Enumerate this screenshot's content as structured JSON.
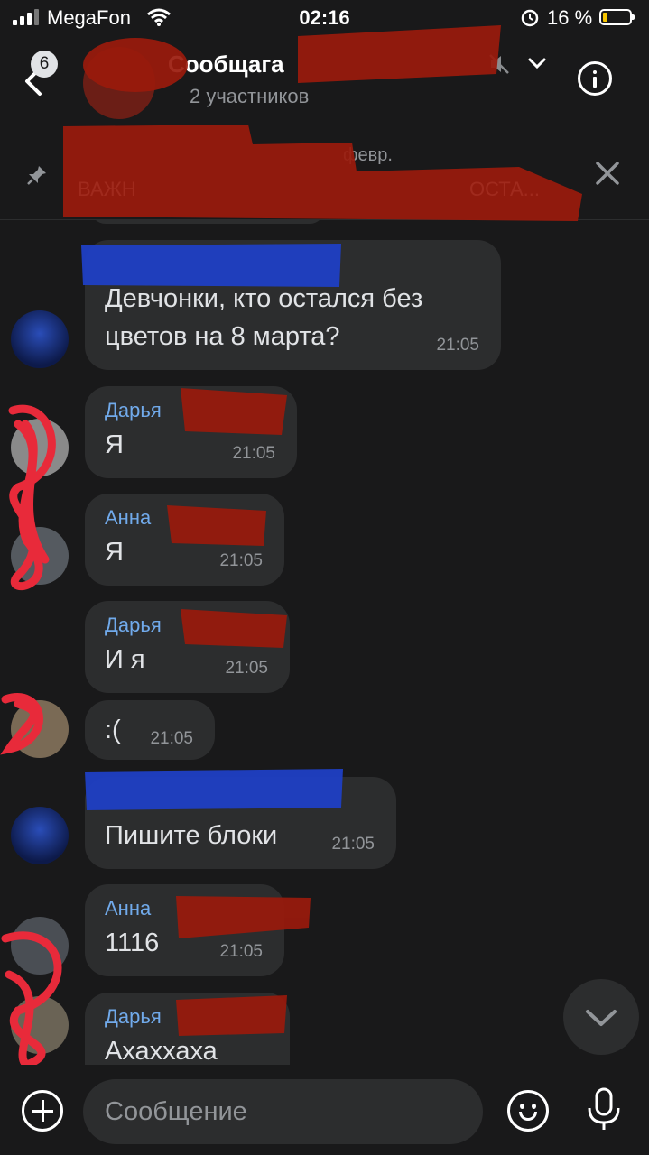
{
  "status_bar": {
    "carrier": "MegaFon",
    "time": "02:16",
    "battery_percent": "16 %",
    "battery_level": 0.16
  },
  "header": {
    "unread_count": "6",
    "title": "Сообщага",
    "subtitle": "2 участников",
    "back_icon": "chevron-left-icon",
    "mute_icon": "muted-speaker-icon",
    "menu_icon": "chevron-down-icon",
    "info_icon": "info-icon"
  },
  "pinned": {
    "title": "февр.",
    "text": "ВАЖН",
    "text_suffix": "ОСТА...",
    "pin_icon": "pin-icon",
    "close_icon": "close-icon"
  },
  "messages": [
    {
      "name": "",
      "text": "Девчонки, кто остался без цветов на 8 марта?",
      "time": "21:05"
    },
    {
      "name": "Дарья",
      "text": "Я",
      "time": "21:05"
    },
    {
      "name": "Анна",
      "text": "Я",
      "time": "21:05"
    },
    {
      "name": "Дарья",
      "text": "И я",
      "time": "21:05"
    },
    {
      "name": "",
      "text": ":(",
      "time": "21:05"
    },
    {
      "name": "",
      "text": "Пишите блоки",
      "time": "21:05"
    },
    {
      "name": "Анна",
      "text": "1116",
      "time": "21:05"
    },
    {
      "name": "Дарья",
      "text": "Ахаххаха",
      "time": ""
    }
  ],
  "composer": {
    "placeholder": "Сообщение",
    "attach_icon": "plus-circle-icon",
    "emoji_icon": "smile-icon",
    "mic_icon": "microphone-icon"
  },
  "scroll_icon": "chevron-down-icon",
  "colors": {
    "background": "#19191a",
    "bubble": "#2c2d2e",
    "name": "#71aaeb",
    "secondary": "#929599"
  }
}
